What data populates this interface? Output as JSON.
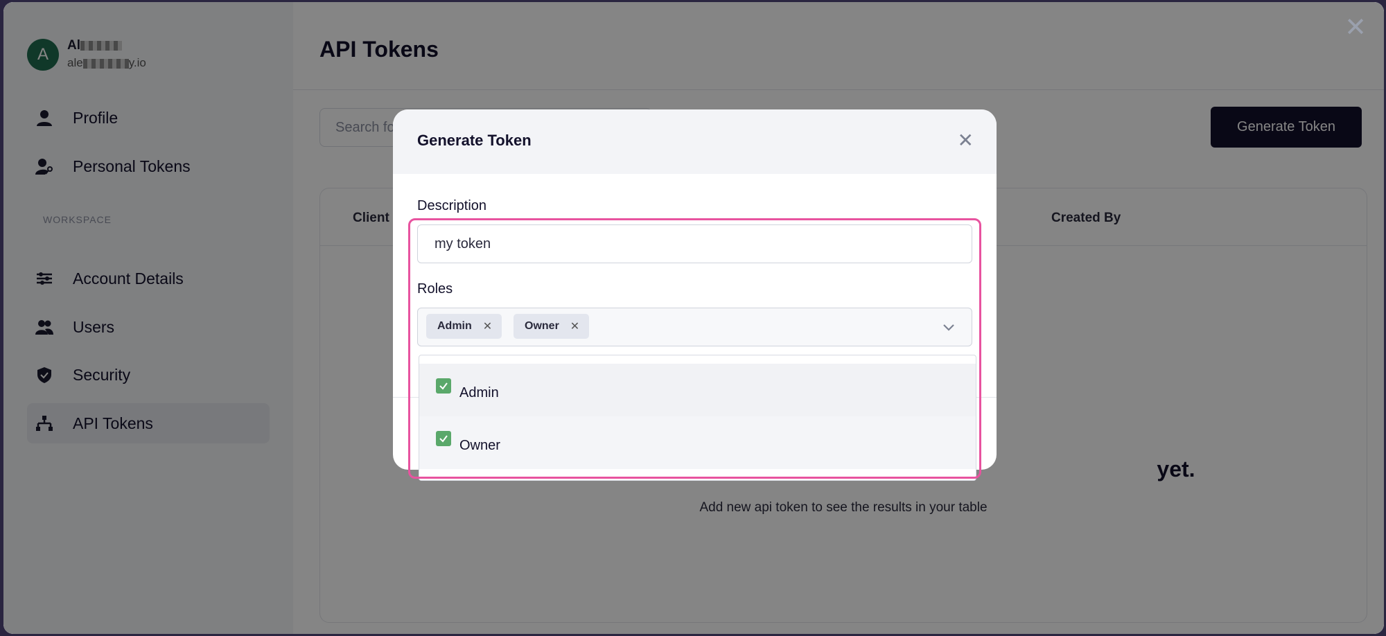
{
  "user": {
    "initial": "A",
    "name": "Al",
    "email_prefix": "ale",
    "email_suffix": "y.io"
  },
  "sidebar": {
    "items_top": [
      {
        "label": "Profile",
        "icon": "person-icon"
      },
      {
        "label": "Personal Tokens",
        "icon": "person-key-icon"
      }
    ],
    "section_label": "WORKSPACE",
    "items_workspace": [
      {
        "label": "Account Details",
        "icon": "sliders-icon"
      },
      {
        "label": "Users",
        "icon": "users-icon"
      },
      {
        "label": "Security",
        "icon": "shield-icon"
      },
      {
        "label": "API Tokens",
        "icon": "hierarchy-icon",
        "active": true
      }
    ]
  },
  "main": {
    "title": "API Tokens",
    "search_placeholder": "Search fo",
    "generate_button": "Generate Token",
    "table": {
      "headers": [
        "Client I",
        "Created By"
      ]
    },
    "empty_title_fragment": "yet.",
    "empty_subtitle": "Add new api token to see the results in your table"
  },
  "modal": {
    "title": "Generate Token",
    "description_label": "Description",
    "description_value": "my token",
    "roles_label": "Roles",
    "selected_roles": [
      "Admin",
      "Owner"
    ],
    "options": [
      {
        "label": "Admin",
        "checked": true
      },
      {
        "label": "Owner",
        "checked": true
      }
    ]
  },
  "colors": {
    "brand_dark": "#13112b",
    "check_green": "#5aa86a",
    "highlight_pink": "#e8539f"
  }
}
